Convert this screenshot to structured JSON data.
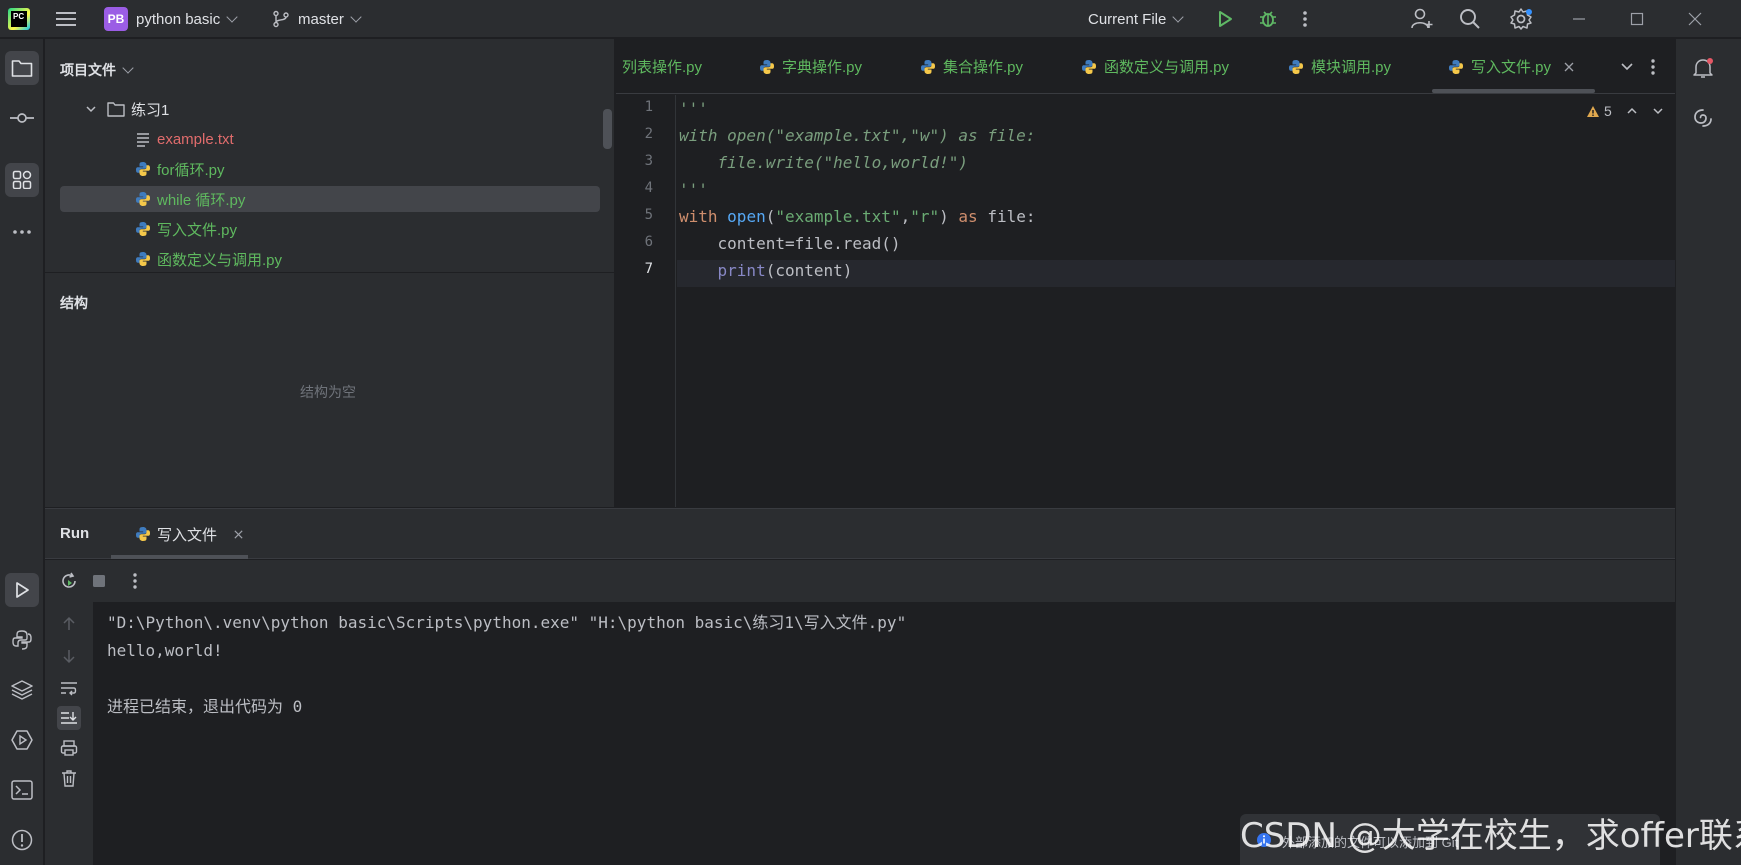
{
  "titlebar": {
    "logo_text": "PC",
    "project_badge": "PB",
    "project_name": "python basic",
    "branch": "master",
    "run_config": "Current File"
  },
  "project_panel": {
    "title": "项目文件",
    "folder": "练习1",
    "files": [
      {
        "name": "example.txt",
        "type": "text"
      },
      {
        "name": "for循环.py",
        "type": "python"
      },
      {
        "name": "while 循环.py",
        "type": "python",
        "selected": true
      },
      {
        "name": "写入文件.py",
        "type": "python"
      },
      {
        "name": "函数定义与调用.py",
        "type": "python"
      }
    ],
    "structure_title": "结构",
    "structure_empty": "结构为空"
  },
  "editor": {
    "tabs": [
      {
        "label": "列表操作.py"
      },
      {
        "label": "字典操作.py"
      },
      {
        "label": "集合操作.py"
      },
      {
        "label": "函数定义与调用.py"
      },
      {
        "label": "模块调用.py"
      },
      {
        "label": "写入文件.py",
        "active": true
      }
    ],
    "warning_count": "5",
    "line_numbers": [
      "1",
      "2",
      "3",
      "4",
      "5",
      "6",
      "7"
    ],
    "current_line": 7,
    "code": {
      "l1": "'''",
      "l2": "with open(\"example.txt\",\"w\") as file:",
      "l3": "    file.write(\"hello,world!\")",
      "l4": "'''",
      "l5_kw1": "with",
      "l5_fn": "open",
      "l5_paren": "(",
      "l5_s1": "\"example.txt\"",
      "l5_comma": ",",
      "l5_s2": "\"r\"",
      "l5_close": ")",
      "l5_kw2": "as",
      "l5_var": "file:",
      "l6": "    content=file.read()",
      "l7_indent": "    ",
      "l7_fn": "print",
      "l7_rest": "(content)"
    }
  },
  "run_panel": {
    "title": "Run",
    "tab_label": "写入文件",
    "console": [
      "\"D:\\Python\\.venv\\python basic\\Scripts\\python.exe\" \"H:\\python basic\\练习1\\写入文件.py\"",
      "hello,world!",
      "",
      "进程已结束，退出代码为 0"
    ]
  },
  "watermark": "CSDN @大学在校生，求offer联系",
  "notification_partial": "外部添加的文件可以添加到 Git"
}
